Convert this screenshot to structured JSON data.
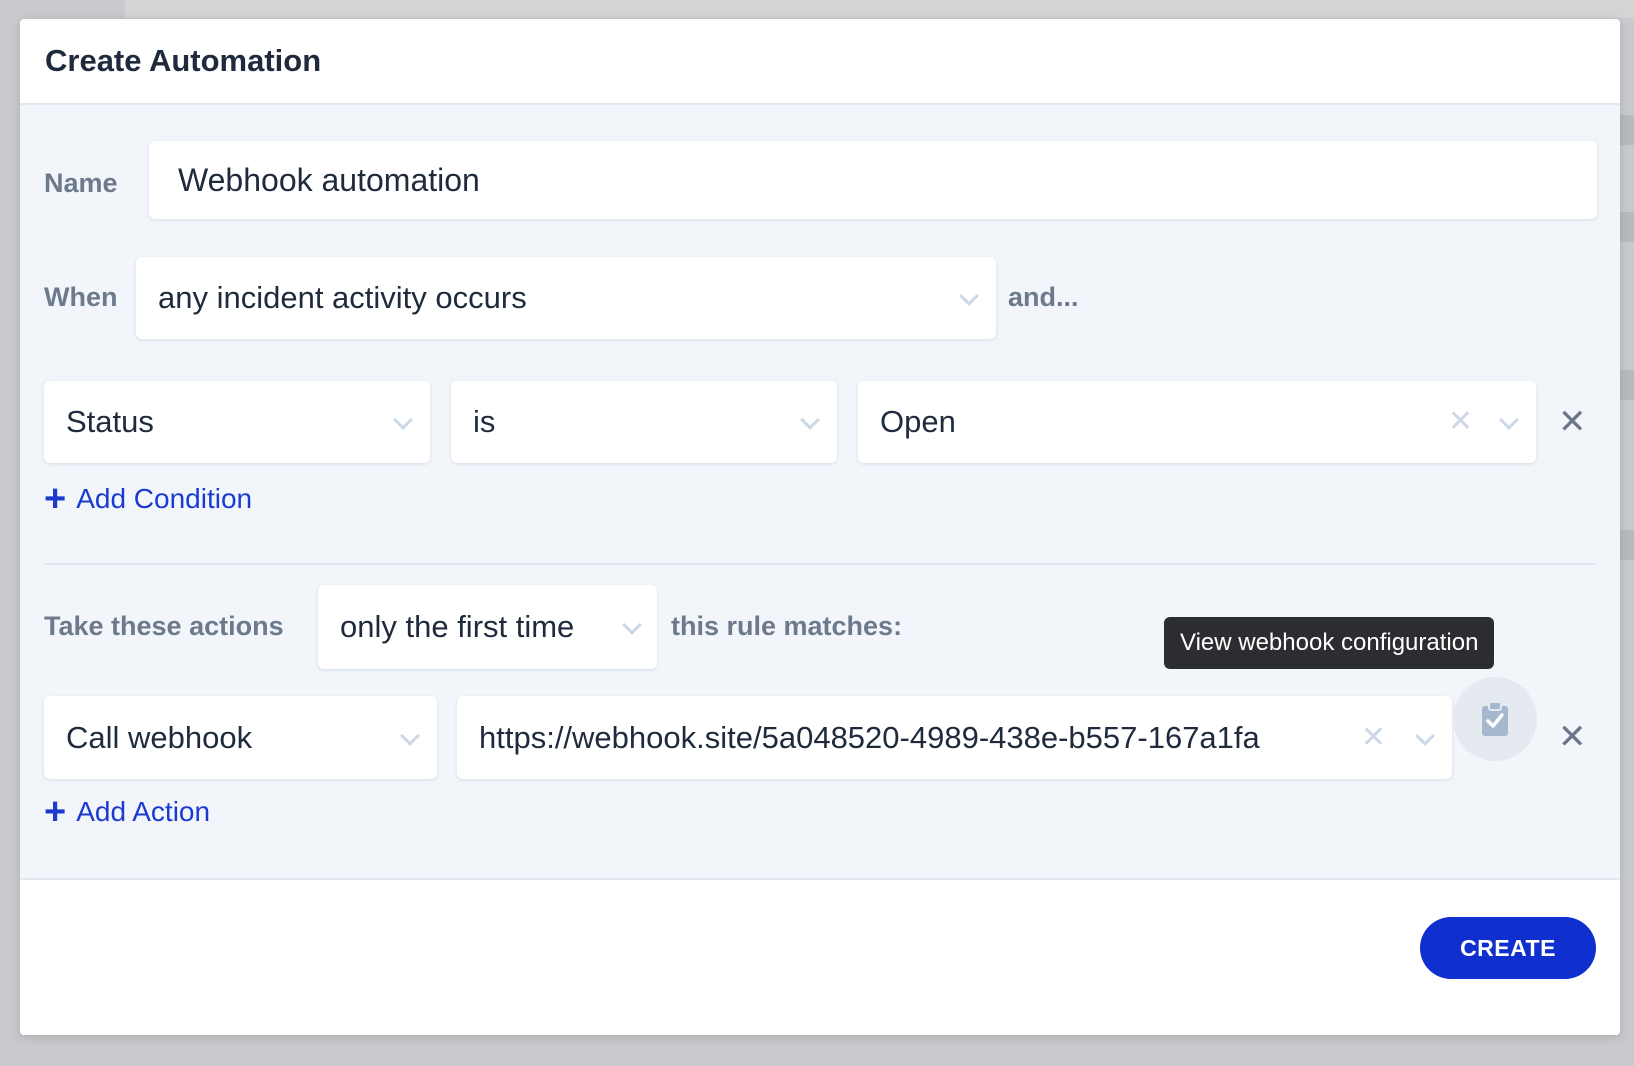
{
  "modal": {
    "title": "Create Automation",
    "name_label": "Name",
    "name_value": "Webhook automation",
    "when_label": "When",
    "trigger_value": "any incident activity occurs",
    "and_label": "and...",
    "condition": {
      "field": "Status",
      "operator": "is",
      "value": "Open"
    },
    "add_condition": "Add Condition",
    "actions_label": "Take these actions",
    "frequency_value": "only the first time",
    "rule_matches_label": "this rule matches:",
    "action": {
      "type": "Call webhook",
      "url": "https://webhook.site/5a048520-4989-438e-b557-167a1fa"
    },
    "tooltip": "View webhook configuration",
    "add_action": "Add Action",
    "create_button": "CREATE"
  },
  "icons": {
    "clipboard": "clipboard-check-icon",
    "clear": "clear-icon",
    "remove": "close-icon",
    "chevron": "chevron-down-icon",
    "plus": "plus-icon"
  },
  "colors": {
    "accent": "#0f2fcf",
    "link": "#1a3ad0",
    "body_bg": "#f2f6fb"
  }
}
